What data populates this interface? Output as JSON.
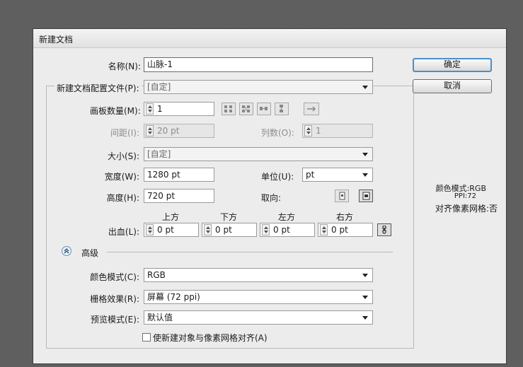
{
  "dialog": {
    "title": "新建文档",
    "name_label": "名称(N):",
    "name_value": "山脉-1",
    "profile_label": "新建文档配置文件(P):",
    "profile_value": "[自定]",
    "artboards_label": "画板数量(M):",
    "artboards_value": "1",
    "spacing_label": "间距(I):",
    "spacing_value": "20 pt",
    "columns_label": "列数(O):",
    "columns_value": "1",
    "size_label": "大小(S):",
    "size_value": "[自定]",
    "width_label": "宽度(W):",
    "width_value": "1280 pt",
    "units_label": "单位(U):",
    "units_value": "pt",
    "height_label": "高度(H):",
    "height_value": "720 pt",
    "orientation_label": "取向:",
    "bleed_label": "出血(L):",
    "bleed_headers": [
      "上方",
      "下方",
      "左方",
      "右方"
    ],
    "bleed_values": [
      "0 pt",
      "0 pt",
      "0 pt",
      "0 pt"
    ],
    "advanced_label": "高级",
    "color_mode_label": "颜色模式(C):",
    "color_mode_value": "RGB",
    "raster_label": "栅格效果(R):",
    "raster_value": "屏幕 (72 ppi)",
    "preview_label": "预览模式(E):",
    "preview_value": "默认值",
    "align_pixel_label": "使新建对象与像素网格对齐(A)",
    "ok_label": "确定",
    "cancel_label": "取消",
    "info_color_mode": "颜色模式:RGB",
    "info_ppi": "PPI:72",
    "info_align": "对齐像素网格:否"
  },
  "icons": {
    "arrange_buttons": [
      "grid-by-row-icon",
      "grid-by-column-icon",
      "arrange-by-row-icon",
      "arrange-by-column-icon",
      "right-to-left-icon"
    ],
    "orientation": [
      "portrait-icon",
      "landscape-icon"
    ],
    "link": "chain-link-icon",
    "advanced_toggle": "chevron-up-circle-icon"
  }
}
